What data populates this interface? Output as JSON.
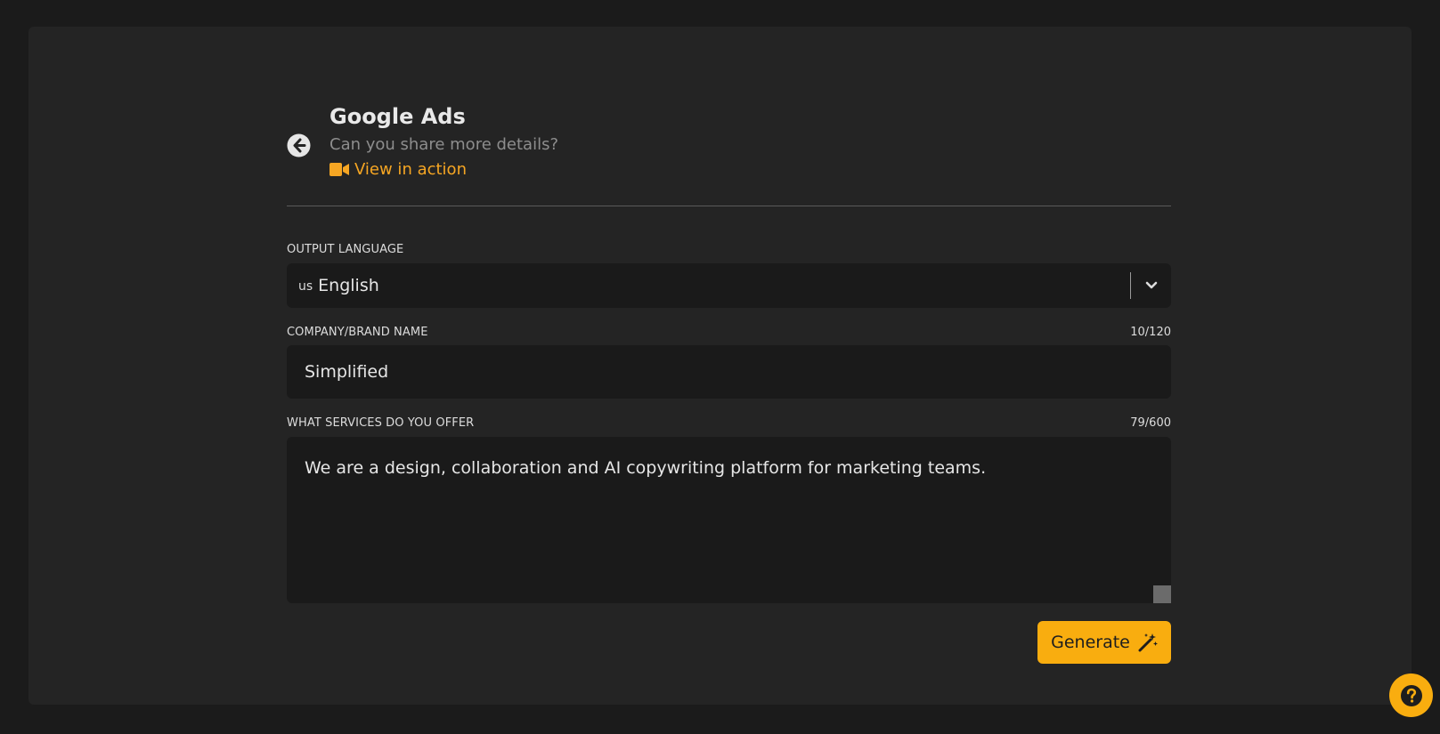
{
  "header": {
    "title": "Google Ads",
    "subtitle": "Can you share more details?",
    "view_in_action": "View in action"
  },
  "fields": {
    "output_language": {
      "label": "OUTPUT LANGUAGE",
      "flag": "us",
      "value": "English"
    },
    "company_name": {
      "label": "COMPANY/BRAND NAME",
      "counter": "10/120",
      "value": "Simplified"
    },
    "services": {
      "label": "WHAT SERVICES DO YOU OFFER",
      "counter": "79/600",
      "value": "We are a design, collaboration and AI copywriting platform for marketing teams."
    }
  },
  "actions": {
    "generate_label": "Generate"
  },
  "icons": {
    "back": "arrow-circle-left-icon",
    "video": "video-camera-icon",
    "chevron": "chevron-down-icon",
    "magic": "magic-wand-icon",
    "help": "question-icon"
  },
  "colors": {
    "accent": "#f9ad0f",
    "link": "#f6a623",
    "panel": "#242424",
    "field_bg": "#1a1a1a",
    "page_bg": "#1b1b1b"
  }
}
